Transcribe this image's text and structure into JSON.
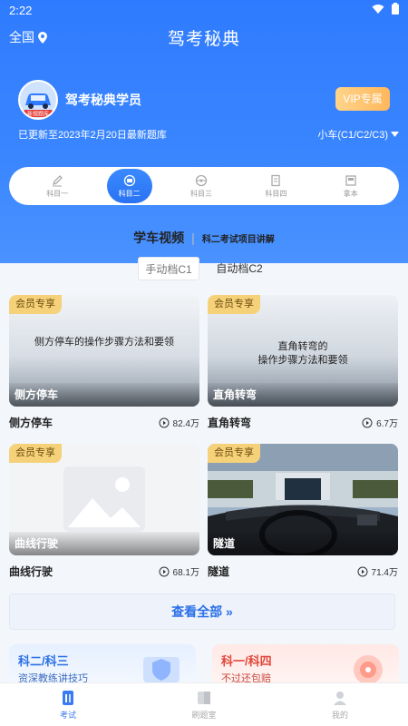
{
  "status": {
    "time": "2:22"
  },
  "header": {
    "region": "全国",
    "title": "驾考秘典"
  },
  "user": {
    "name": "驾考秘典学员",
    "avatar_text": "新规题库",
    "vip_label": "VIP专属",
    "update_text": "已更新至2023年2月20日最新题库",
    "car_type": "小车(C1/C2/C3)"
  },
  "subjects": [
    {
      "label": "科目一",
      "icon": "pen-icon"
    },
    {
      "label": "科目二",
      "icon": "steering-icon"
    },
    {
      "label": "科目三",
      "icon": "wheel-icon"
    },
    {
      "label": "科目四",
      "icon": "book-icon"
    },
    {
      "label": "拿本",
      "icon": "license-icon"
    }
  ],
  "section": {
    "title": "学车视频",
    "subtitle": "科二考试项目讲解"
  },
  "gears": [
    {
      "label": "手动档C1"
    },
    {
      "label": "自动档C2"
    }
  ],
  "videos": [
    {
      "badge": "会员专享",
      "overlay": "侧方停车的操作步骤方法和要领",
      "label": "侧方停车",
      "title": "侧方停车",
      "views": "82.4万"
    },
    {
      "badge": "会员专享",
      "overlay": "直角转弯的\n操作步骤方法和要领",
      "label": "直角转弯",
      "title": "直角转弯",
      "views": "6.7万"
    },
    {
      "badge": "会员专享",
      "overlay": "",
      "label": "曲线行驶",
      "title": "曲线行驶",
      "views": "68.1万"
    },
    {
      "badge": "会员专享",
      "overlay": "",
      "label": "隧道",
      "title": "隧道",
      "views": "71.4万"
    }
  ],
  "view_all": "查看全部 »",
  "promos": [
    {
      "title": "科二/科三",
      "subtitle": "资深教练讲技巧"
    },
    {
      "title": "科一/科四",
      "subtitle": "不过还包赔"
    }
  ],
  "tabbar": [
    {
      "label": "考试"
    },
    {
      "label": "刷题室"
    },
    {
      "label": "我的"
    }
  ],
  "colors": {
    "primary": "#3a86ff",
    "vip": "#ffb75c",
    "badge": "#f5d27a"
  }
}
